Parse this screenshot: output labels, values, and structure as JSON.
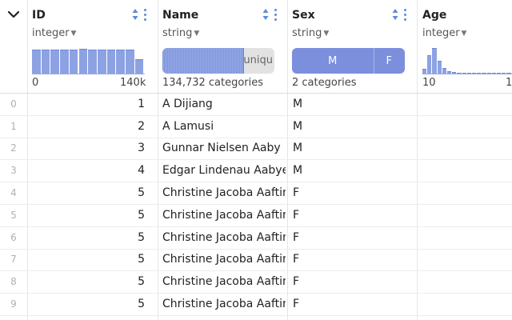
{
  "header": {
    "expand_icon": "chevron-down-icon",
    "columns": [
      {
        "name": "ID",
        "type": "integer",
        "stat_min": "0",
        "stat_max": "140k",
        "hist": [
          0.95,
          0.95,
          0.95,
          0.95,
          0.95,
          0.97,
          0.95,
          0.95,
          0.95,
          0.95,
          0.95,
          0.55
        ]
      },
      {
        "name": "Name",
        "type": "string",
        "unique_label": "uniqu",
        "unique_fill": 0.72,
        "stat": "134,732 categories"
      },
      {
        "name": "Sex",
        "type": "string",
        "cat_major": "M",
        "cat_minor": "F",
        "major_share": 0.72,
        "stat": "2 categories"
      },
      {
        "name": "Age",
        "type": "integer",
        "stat_min": "10",
        "stat_max": "1",
        "hist": [
          0.18,
          0.72,
          1.0,
          0.5,
          0.22,
          0.08,
          0.05,
          0.03,
          0.03,
          0.02,
          0.02,
          0.02,
          0.02,
          0.02,
          0.02,
          0.02,
          0.02,
          0.02
        ]
      }
    ]
  },
  "rows": [
    {
      "index": "0",
      "id": "1",
      "name": "A Dijiang",
      "sex": "M"
    },
    {
      "index": "1",
      "id": "2",
      "name": "A Lamusi",
      "sex": "M"
    },
    {
      "index": "2",
      "id": "3",
      "name": "Gunnar Nielsen Aaby",
      "sex": "M"
    },
    {
      "index": "3",
      "id": "4",
      "name": "Edgar Lindenau Aabye",
      "sex": "M"
    },
    {
      "index": "4",
      "id": "5",
      "name": "Christine Jacoba Aaftink",
      "sex": "F"
    },
    {
      "index": "5",
      "id": "5",
      "name": "Christine Jacoba Aaftink",
      "sex": "F"
    },
    {
      "index": "6",
      "id": "5",
      "name": "Christine Jacoba Aaftink",
      "sex": "F"
    },
    {
      "index": "7",
      "id": "5",
      "name": "Christine Jacoba Aaftink",
      "sex": "F"
    },
    {
      "index": "8",
      "id": "5",
      "name": "Christine Jacoba Aaftink",
      "sex": "F"
    },
    {
      "index": "9",
      "id": "5",
      "name": "Christine Jacoba Aaftink",
      "sex": "F"
    }
  ],
  "colors": {
    "accent": "#7b8fdc",
    "bar": "#8da2e3",
    "icon": "#5b8bd8"
  }
}
